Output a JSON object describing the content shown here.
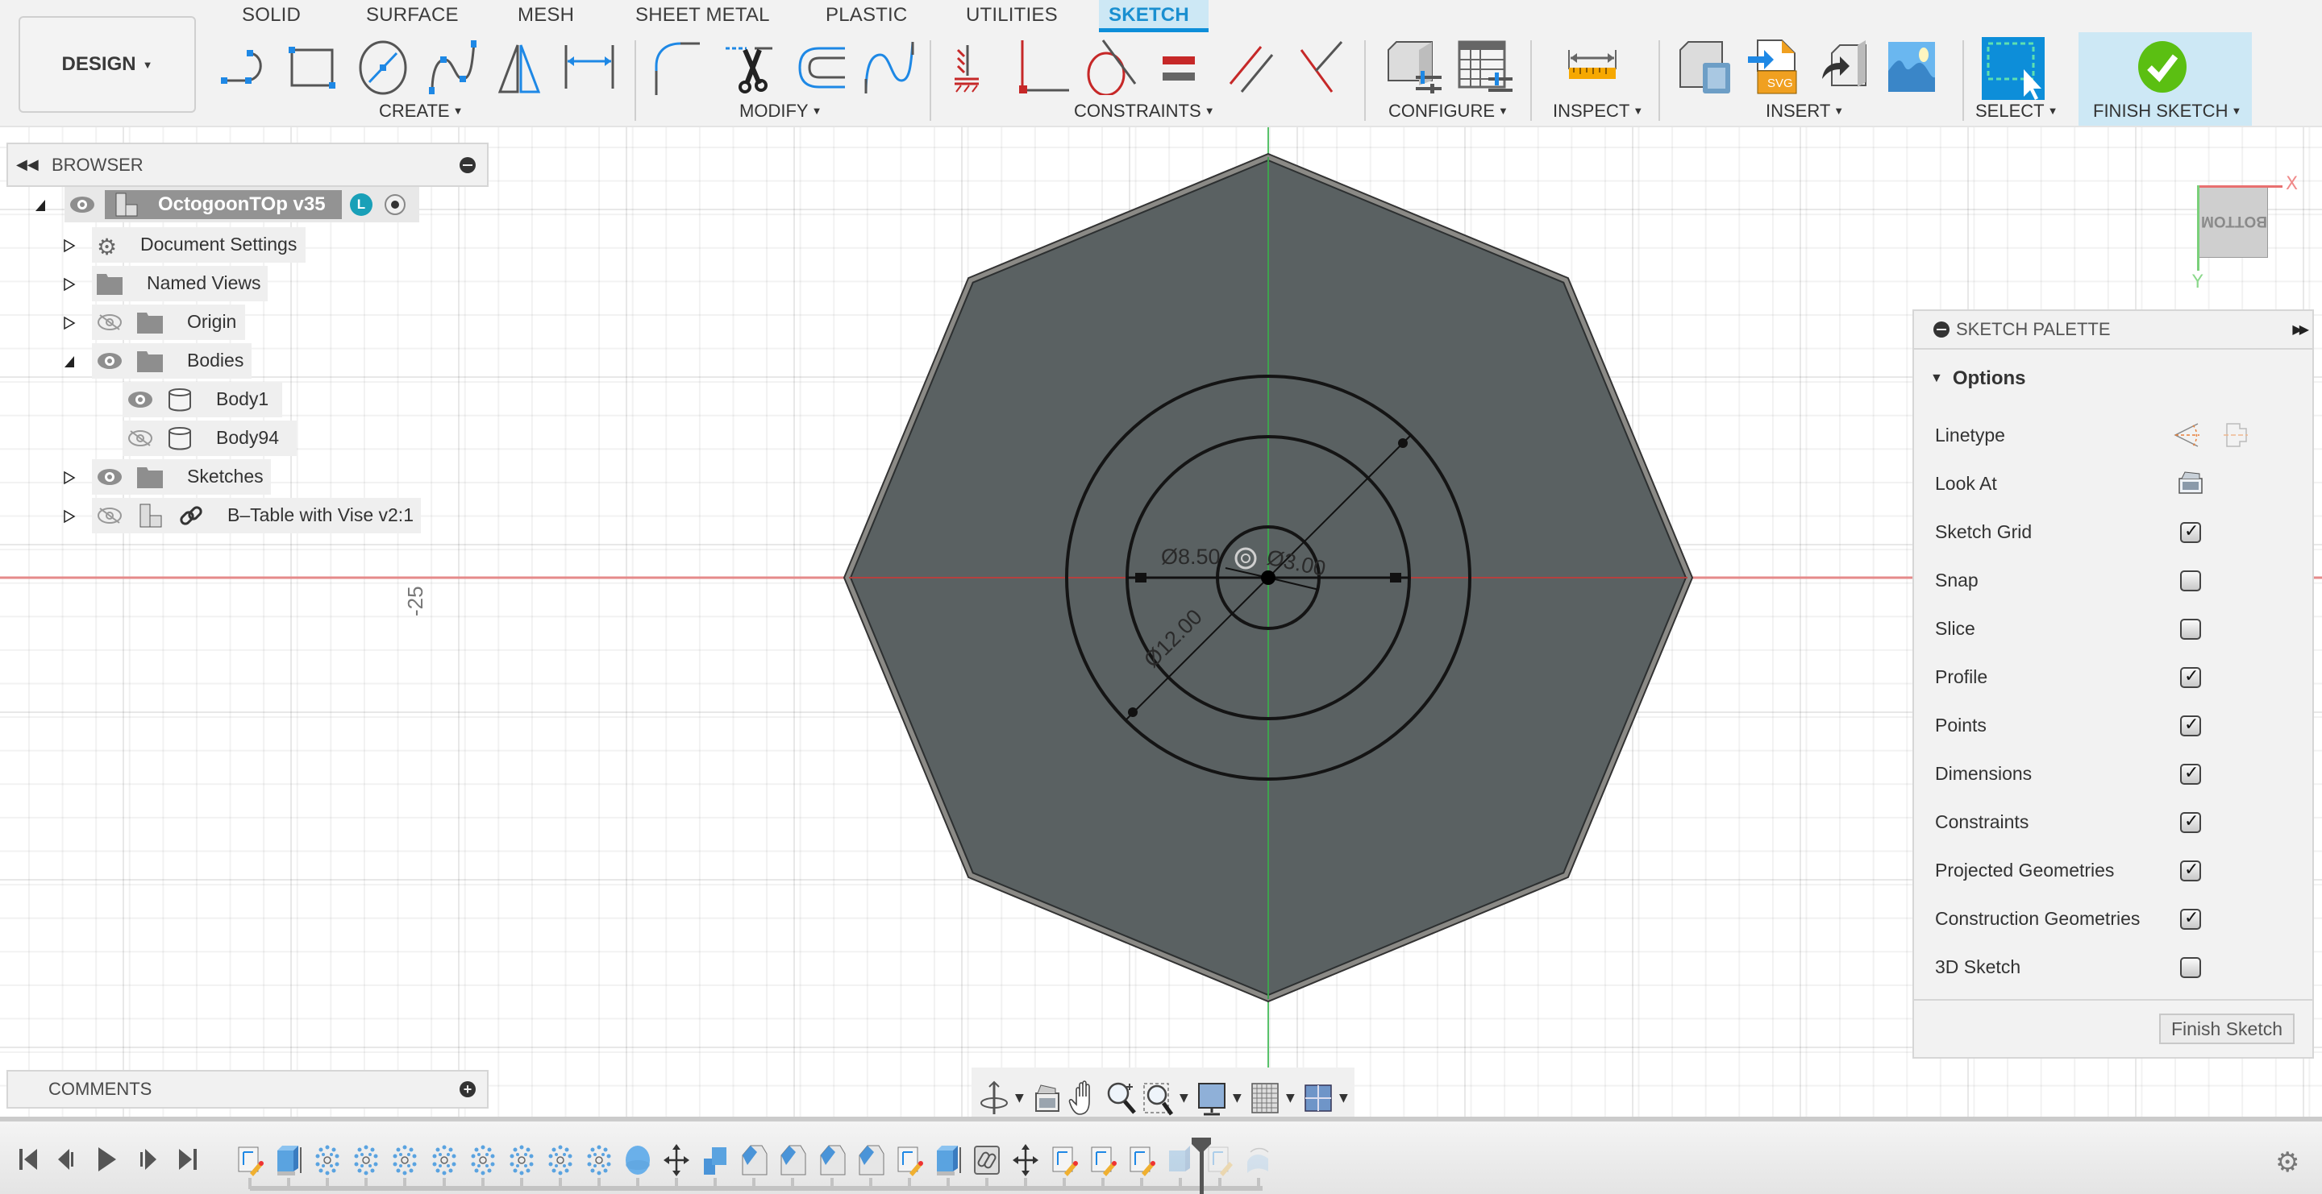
{
  "toolbar": {
    "workspace": "DESIGN",
    "tabs": [
      {
        "label": "SOLID"
      },
      {
        "label": "SURFACE"
      },
      {
        "label": "MESH"
      },
      {
        "label": "SHEET METAL"
      },
      {
        "label": "PLASTIC"
      },
      {
        "label": "UTILITIES"
      },
      {
        "label": "SKETCH",
        "active": true
      }
    ],
    "groups": {
      "create": "CREATE",
      "modify": "MODIFY",
      "constraints": "CONSTRAINTS",
      "configure": "CONFIGURE",
      "inspect": "INSPECT",
      "insert": "INSERT",
      "select": "SELECT",
      "finish": "FINISH SKETCH"
    },
    "tools": {
      "create": [
        "line-icon",
        "rectangle-icon",
        "circle-icon",
        "spline-icon",
        "mirror-icon",
        "sketch-dimension-icon"
      ],
      "modify": [
        "fillet-icon",
        "trim-icon",
        "offset-icon",
        "fit-point-spline-icon"
      ],
      "constraints": [
        "fix-icon",
        "coincident-icon",
        "tangent-icon",
        "equal-icon",
        "parallel-icon",
        "perpendicular-icon"
      ],
      "configure": [
        "change-parameters-icon",
        "configure-table-icon"
      ],
      "inspect": [
        "measure-icon"
      ],
      "insert": [
        "insert-derive-icon",
        "insert-svg-icon",
        "insert-mesh-icon",
        "canvas-icon"
      ],
      "select": [
        "window-select-icon"
      ],
      "finish": [
        "finish-sketch-check-icon"
      ]
    }
  },
  "browser": {
    "title": "BROWSER",
    "root": {
      "label": "OctogoonTOp v35",
      "badge": "L"
    },
    "items": [
      {
        "label": "Document Settings",
        "icon": "gear-icon",
        "expanded": false
      },
      {
        "label": "Named Views",
        "icon": "folder-icon",
        "expanded": false
      },
      {
        "label": "Origin",
        "icon": "folder-icon",
        "visible": false,
        "expanded": false
      },
      {
        "label": "Bodies",
        "icon": "folder-icon",
        "visible": true,
        "expanded": true
      },
      {
        "label": "Body1",
        "icon": "body-icon",
        "visible": true
      },
      {
        "label": "Body94",
        "icon": "body-icon",
        "visible": false
      },
      {
        "label": "Sketches",
        "icon": "folder-icon",
        "visible": true,
        "expanded": false
      },
      {
        "label": "B–Table with Vise v2:1",
        "icon": "component-icon",
        "visible": false,
        "linked": true,
        "expanded": false
      }
    ]
  },
  "viewport": {
    "grid_label": "-25",
    "view_cube": {
      "face": "BOTTOM",
      "x_axis": "X",
      "y_axis": "Y"
    },
    "dimensions": {
      "d1": "Ø12.00",
      "d2": "Ø8.50",
      "d3": "Ø3.00"
    },
    "colors": {
      "body_fill": "#5a6162",
      "x_axis": "#e06666",
      "y_axis": "#4caf50"
    }
  },
  "palette": {
    "title": "SKETCH PALETTE",
    "section": "Options",
    "linetype_label": "Linetype",
    "look_at_label": "Look At",
    "options": [
      {
        "label": "Sketch Grid",
        "checked": true
      },
      {
        "label": "Snap",
        "checked": false
      },
      {
        "label": "Slice",
        "checked": false
      },
      {
        "label": "Profile",
        "checked": true
      },
      {
        "label": "Points",
        "checked": true
      },
      {
        "label": "Dimensions",
        "checked": true
      },
      {
        "label": "Constraints",
        "checked": true
      },
      {
        "label": "Projected Geometries",
        "checked": true
      },
      {
        "label": "Construction Geometries",
        "checked": true
      },
      {
        "label": "3D Sketch",
        "checked": false
      }
    ],
    "finish_button": "Finish Sketch"
  },
  "comments": {
    "title": "COMMENTS"
  },
  "navbar": [
    "orbit-icon",
    "look-at-icon",
    "pan-icon",
    "zoom-icon",
    "zoom-window-icon",
    "display-settings-icon",
    "grid-settings-icon",
    "viewports-icon"
  ],
  "timeline": {
    "controls": [
      "first-icon",
      "previous-icon",
      "play-icon",
      "next-icon",
      "last-icon"
    ],
    "features": [
      "sketch",
      "extrude",
      "pattern",
      "pattern",
      "pattern",
      "pattern",
      "pattern",
      "pattern",
      "pattern",
      "pattern",
      "sphere",
      "move",
      "combine",
      "chamfer",
      "chamfer",
      "chamfer",
      "chamfer",
      "sketch",
      "extrude",
      "link",
      "move",
      "sketch",
      "sketch",
      "sketch",
      "extrude-suppressed",
      "sketch-suppressed",
      "revolve-suppressed"
    ]
  }
}
